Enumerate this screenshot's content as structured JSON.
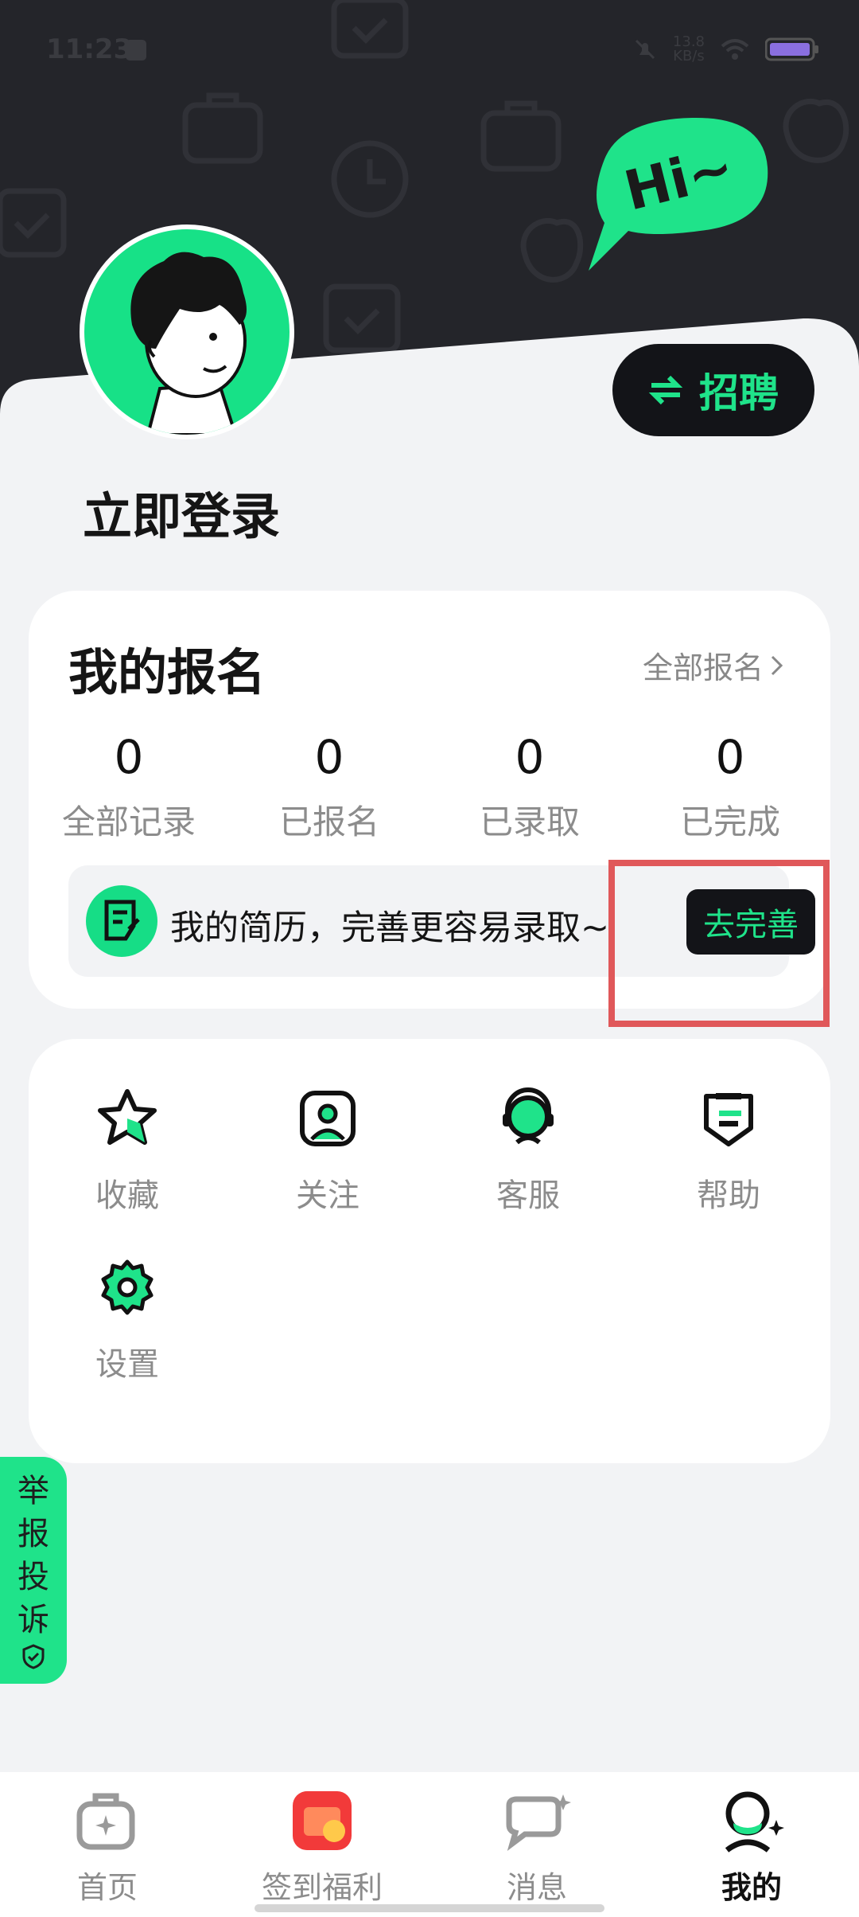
{
  "status_bar": {
    "time": "11:23",
    "net_speed": "13.8",
    "net_unit": "KB/s"
  },
  "header": {
    "hi_text": "Hi~",
    "recruit_label": "招聘"
  },
  "profile": {
    "login_label": "立即登录"
  },
  "registration": {
    "title": "我的报名",
    "all_link": "全部报名",
    "stats": [
      {
        "value": "0",
        "label": "全部记录"
      },
      {
        "value": "0",
        "label": "已报名"
      },
      {
        "value": "0",
        "label": "已录取"
      },
      {
        "value": "0",
        "label": "已完成"
      }
    ],
    "resume_text": "我的简历，完善更容易录取~",
    "resume_button": "去完善"
  },
  "tools": [
    {
      "label": "收藏",
      "icon": "star-icon"
    },
    {
      "label": "关注",
      "icon": "follow-icon"
    },
    {
      "label": "客服",
      "icon": "customer-service-icon"
    },
    {
      "label": "帮助",
      "icon": "help-icon"
    },
    {
      "label": "设置",
      "icon": "settings-icon"
    }
  ],
  "report_tab": {
    "chars": [
      "举",
      "报",
      "投",
      "诉"
    ]
  },
  "tabbar": [
    {
      "label": "首页",
      "icon": "home-icon"
    },
    {
      "label": "签到福利",
      "icon": "gift-icon"
    },
    {
      "label": "消息",
      "icon": "message-icon"
    },
    {
      "label": "我的",
      "icon": "profile-icon",
      "active": true
    }
  ],
  "colors": {
    "accent": "#1fe38a",
    "dark": "#131418",
    "header_bg": "#24252a",
    "highlight": "#e0585a"
  }
}
